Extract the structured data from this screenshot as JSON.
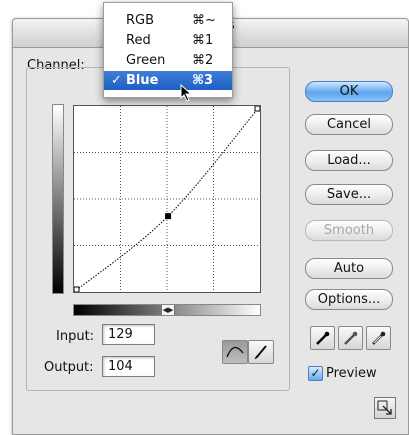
{
  "dialog": {
    "title_fragment": "s",
    "channel_label": "Channel:",
    "channel_menu": [
      {
        "label": "RGB",
        "shortcut": "⌘~",
        "selected": false
      },
      {
        "label": "Red",
        "shortcut": "⌘1",
        "selected": false
      },
      {
        "label": "Green",
        "shortcut": "⌘2",
        "selected": false
      },
      {
        "label": "Blue",
        "shortcut": "⌘3",
        "selected": true,
        "check": "✓"
      }
    ],
    "curve": {
      "points": [
        [
          0,
          0
        ],
        [
          129,
          104
        ],
        [
          255,
          255
        ]
      ],
      "grid_divisions": 4,
      "input_max": 255
    },
    "input_label": "Input:",
    "input_value": "129",
    "output_label": "Output:",
    "output_value": "104",
    "buttons": {
      "ok": "OK",
      "cancel": "Cancel",
      "load": "Load...",
      "save": "Save...",
      "smooth": "Smooth",
      "auto": "Auto",
      "options": "Options..."
    },
    "preview_label": "Preview",
    "preview_checked": true,
    "accent_color": "#3f7ed9"
  }
}
